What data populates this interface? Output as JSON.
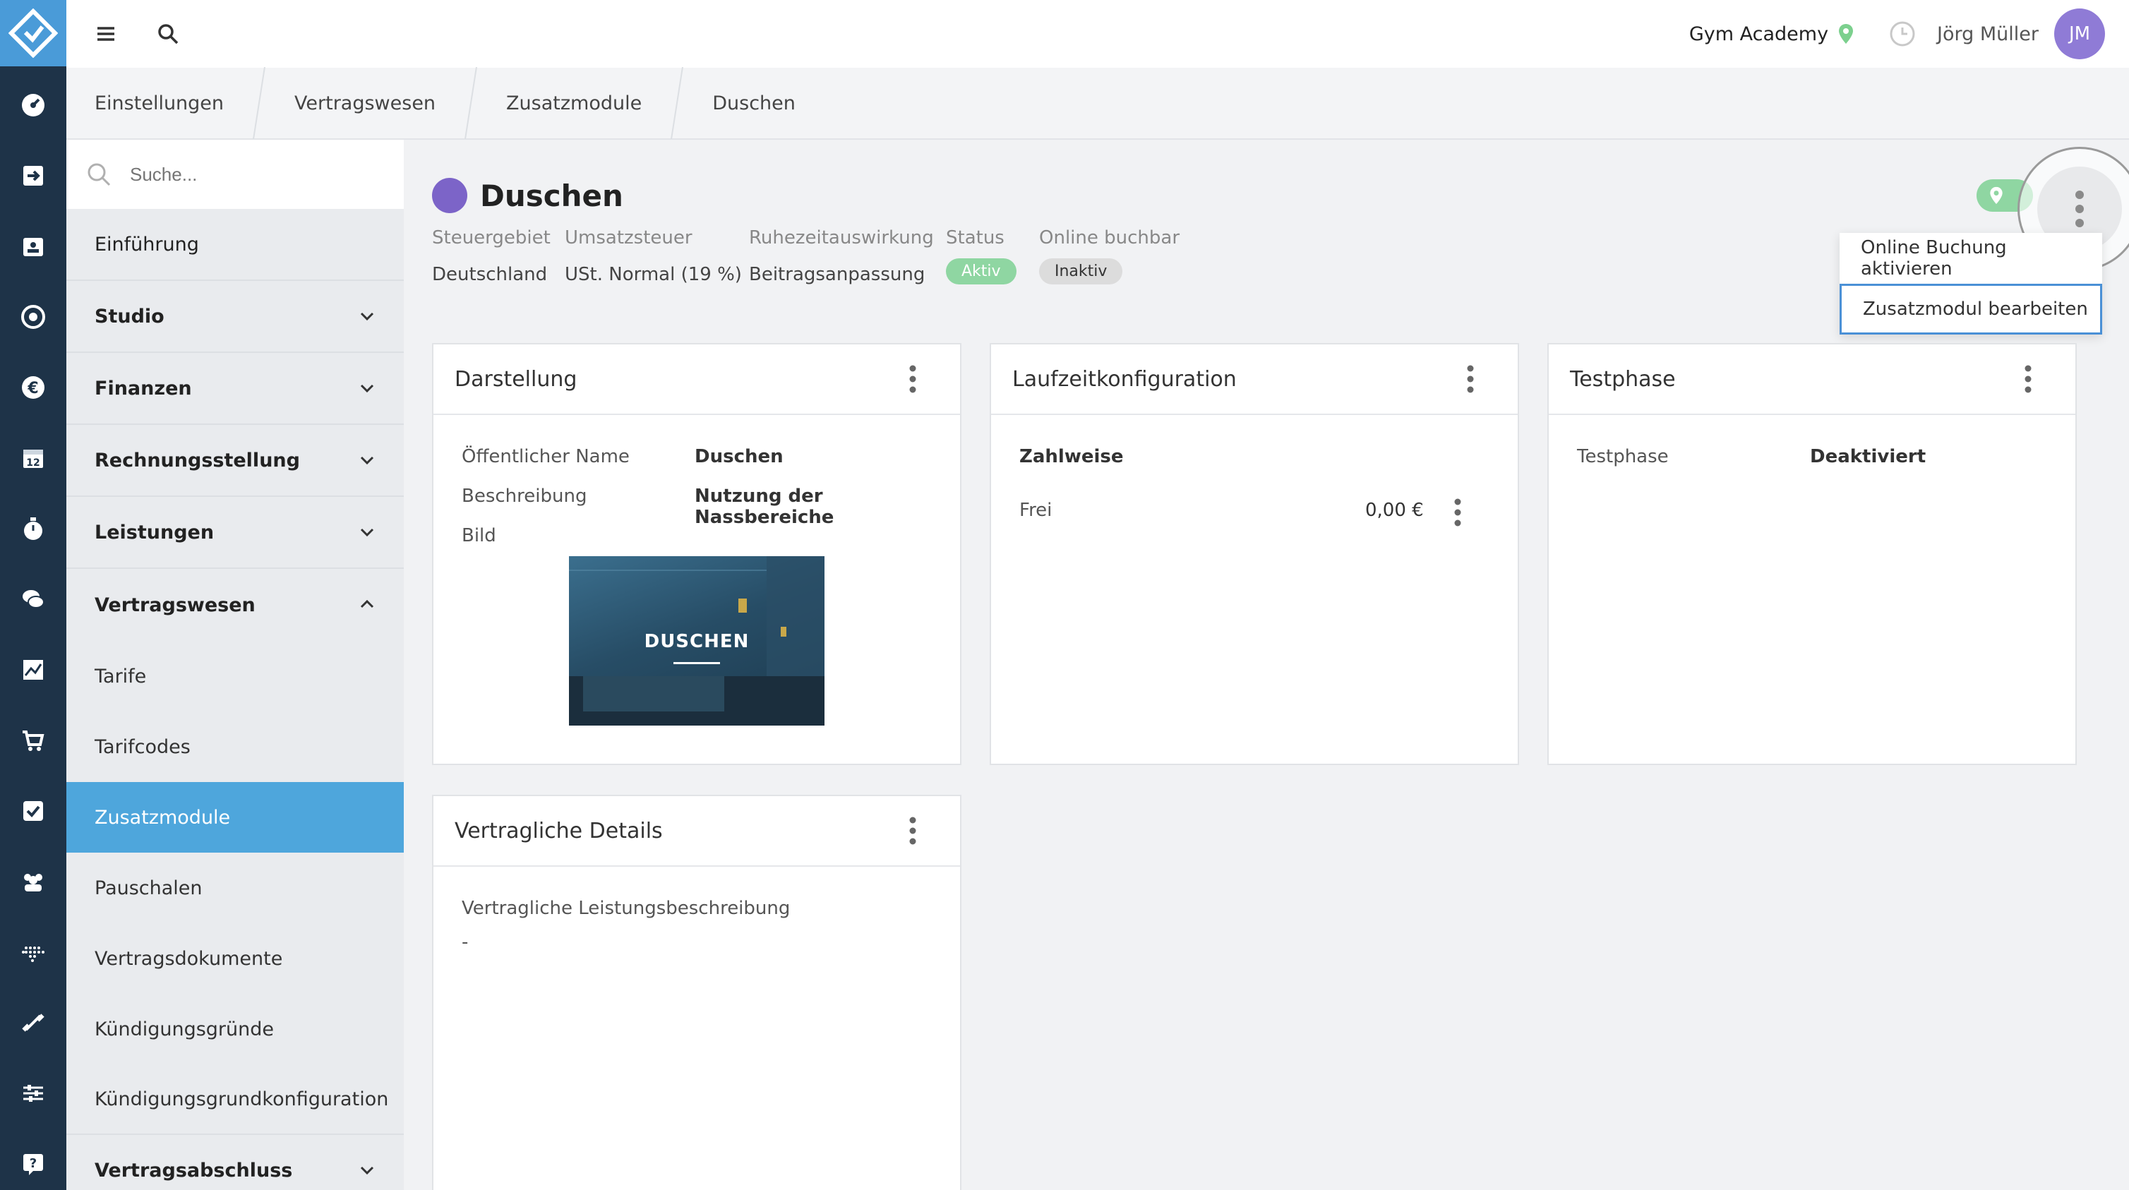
{
  "header": {
    "studio": "Gym Academy",
    "user_name": "Jörg Müller",
    "avatar_initials": "JM"
  },
  "breadcrumb": [
    "Einstellungen",
    "Vertragswesen",
    "Zusatzmodule",
    "Duschen"
  ],
  "sidebar": {
    "search_placeholder": "Suche...",
    "items": [
      {
        "label": "Einführung",
        "bold": false
      },
      {
        "label": "Studio",
        "bold": true,
        "chevron": "down"
      },
      {
        "label": "Finanzen",
        "bold": true,
        "chevron": "down"
      },
      {
        "label": "Rechnungsstellung",
        "bold": true,
        "chevron": "down"
      },
      {
        "label": "Leistungen",
        "bold": true,
        "chevron": "down"
      },
      {
        "label": "Vertragswesen",
        "bold": true,
        "chevron": "up"
      }
    ],
    "sub_items": [
      "Tarife",
      "Tarifcodes",
      "Zusatzmodule",
      "Pauschalen",
      "Vertragsdokumente",
      "Kündigungsgründe",
      "Kündigungsgrundkonfiguration"
    ],
    "active_sub": "Zusatzmodule",
    "bottom_item": "Vertragsabschluss"
  },
  "page": {
    "title": "Duschen",
    "title_color": "#7c64c8",
    "meta": {
      "steuergebiet_label": "Steuergebiet",
      "steuergebiet_value": "Deutschland",
      "umsatzsteuer_label": "Umsatzsteuer",
      "umsatzsteuer_value": "USt. Normal (19 %)",
      "ruhezeit_label": "Ruhezeitauswirkung",
      "ruhezeit_value": "Beitragsanpassung",
      "status_label": "Status",
      "status_value": "Aktiv",
      "online_label": "Online buchbar",
      "online_value": "Inaktiv"
    }
  },
  "menu": {
    "items": [
      "Online Buchung aktivieren",
      "Zusatzmodul bearbeiten"
    ]
  },
  "cards": {
    "darstellung": {
      "title": "Darstellung",
      "public_name_label": "Öffentlicher Name",
      "public_name_value": "Duschen",
      "description_label": "Beschreibung",
      "description_value": "Nutzung der Nassbereiche",
      "image_label": "Bild",
      "image_text": "DUSCHEN"
    },
    "laufzeit": {
      "title": "Laufzeitkonfiguration",
      "zahlweise_label": "Zahlweise",
      "frei_label": "Frei",
      "frei_value": "0,00 €"
    },
    "testphase": {
      "title": "Testphase",
      "label": "Testphase",
      "value": "Deaktiviert"
    },
    "vertragliche": {
      "title": "Vertragliche Details",
      "label": "Vertragliche Leistungsbeschreibung",
      "value": "-"
    }
  }
}
